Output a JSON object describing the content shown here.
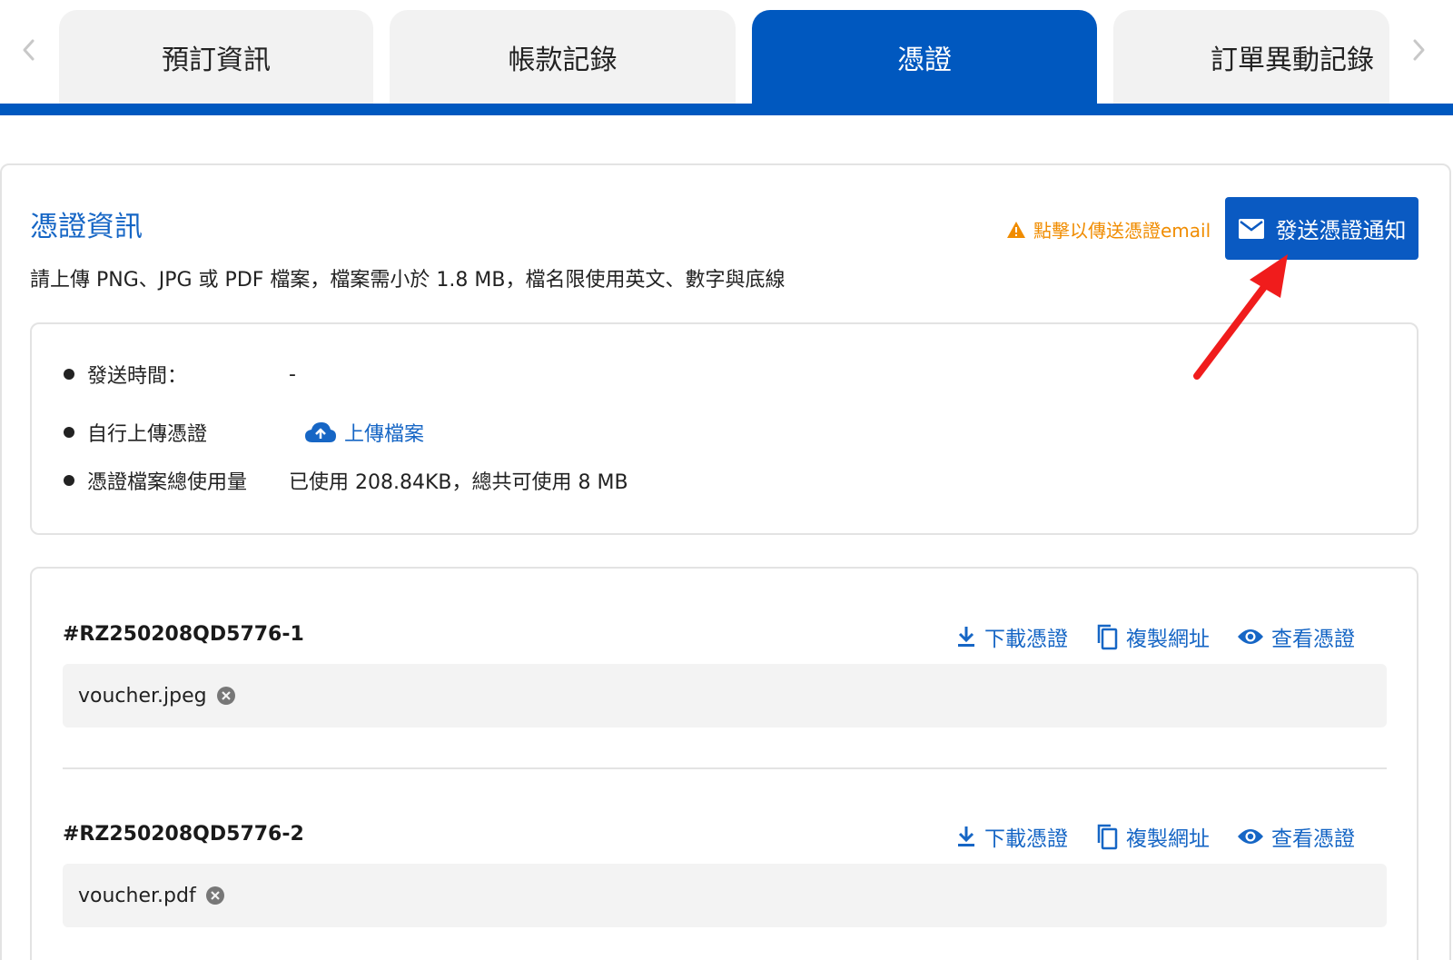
{
  "tabs": [
    {
      "label": "預訂資訊",
      "active": false
    },
    {
      "label": "帳款記錄",
      "active": false
    },
    {
      "label": "憑證",
      "active": true
    },
    {
      "label": "訂單異動記錄",
      "active": false
    }
  ],
  "section": {
    "title": "憑證資訊",
    "hint": "點擊以傳送憑證email",
    "send_button": "發送憑證通知",
    "description": "請上傳 PNG、JPG 或 PDF 檔案，檔案需小於 1.8 MB，檔名限使用英文、數字與底線"
  },
  "info": {
    "send_time_label": "發送時間：",
    "send_time_value": "-",
    "upload_label": "自行上傳憑證",
    "upload_link": "上傳檔案",
    "usage_label": "憑證檔案總使用量",
    "usage_value": "已使用 208.84KB，總共可使用 8 MB"
  },
  "actions": {
    "download": "下載憑證",
    "copy": "複製網址",
    "view": "查看憑證"
  },
  "vouchers": [
    {
      "id": "#RZ250208QD5776-1",
      "file": "voucher.jpeg"
    },
    {
      "id": "#RZ250208QD5776-2",
      "file": "voucher.pdf"
    }
  ],
  "colors": {
    "primary": "#0058bf",
    "link": "#1666c5",
    "warning": "#f08c00",
    "annotation": "#f01c1c"
  }
}
